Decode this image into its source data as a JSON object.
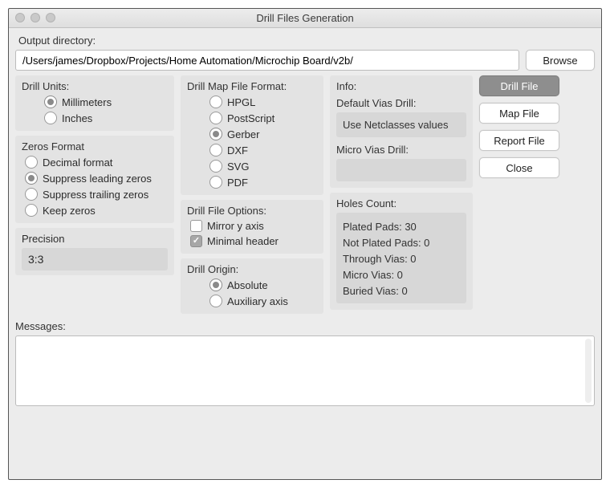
{
  "window": {
    "title": "Drill Files Generation"
  },
  "output": {
    "label": "Output directory:",
    "path": "/Users/james/Dropbox/Projects/Home Automation/Microchip Board/v2b/",
    "browse": "Browse"
  },
  "units": {
    "title": "Drill Units:",
    "options": [
      "Millimeters",
      "Inches"
    ],
    "selected": "Millimeters"
  },
  "zeros": {
    "title": "Zeros Format",
    "options": [
      "Decimal format",
      "Suppress leading zeros",
      "Suppress trailing zeros",
      "Keep zeros"
    ],
    "selected": "Suppress leading zeros"
  },
  "precision": {
    "title": "Precision",
    "value": "3:3"
  },
  "map_format": {
    "title": "Drill Map File Format:",
    "options": [
      "HPGL",
      "PostScript",
      "Gerber",
      "DXF",
      "SVG",
      "PDF"
    ],
    "selected": "Gerber"
  },
  "file_options": {
    "title": "Drill File Options:",
    "mirror": {
      "label": "Mirror y axis",
      "checked": false
    },
    "minimal": {
      "label": "Minimal header",
      "checked": true
    }
  },
  "origin": {
    "title": "Drill Origin:",
    "options": [
      "Absolute",
      "Auxiliary axis"
    ],
    "selected": "Absolute"
  },
  "info": {
    "title": "Info:",
    "default_vias_label": "Default Vias Drill:",
    "default_vias_value": "Use Netclasses values",
    "micro_vias_label": "Micro Vias Drill:",
    "micro_vias_value": ""
  },
  "holes": {
    "title": "Holes Count:",
    "items": [
      "Plated Pads: 30",
      "Not Plated Pads: 0",
      "Through Vias: 0",
      "Micro Vias: 0",
      "Buried Vias: 0"
    ]
  },
  "buttons": {
    "drill_file": "Drill File",
    "map_file": "Map File",
    "report_file": "Report File",
    "close": "Close"
  },
  "messages": {
    "title": "Messages:"
  }
}
